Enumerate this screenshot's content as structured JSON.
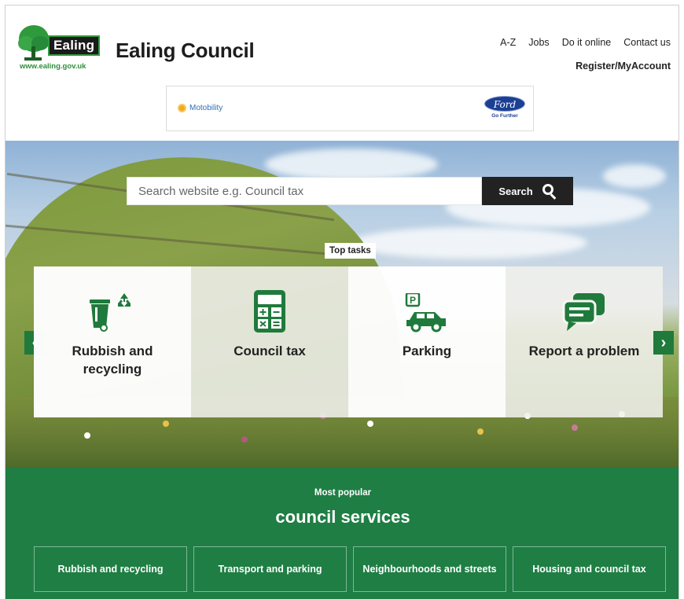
{
  "header": {
    "logo_word": "Ealing",
    "logo_url": "www.ealing.gov.uk",
    "site_title": "Ealing Council",
    "nav": [
      "A-Z",
      "Jobs",
      "Do it online",
      "Contact us"
    ],
    "account_link": "Register/MyAccount"
  },
  "ad": {
    "left_brand": "Motobility",
    "right_brand": "Ford",
    "right_tagline": "Go Further"
  },
  "search": {
    "placeholder": "Search website e.g. Council tax",
    "button_label": "Search"
  },
  "top_tasks": {
    "label": "Top tasks",
    "items": [
      {
        "label": "Rubbish and recycling",
        "icon": "bin-recycle-icon"
      },
      {
        "label": "Council tax",
        "icon": "calculator-icon"
      },
      {
        "label": "Parking",
        "icon": "car-parking-icon"
      },
      {
        "label": "Report a problem",
        "icon": "speech-bubbles-icon"
      }
    ],
    "prev_label": "‹",
    "next_label": "›"
  },
  "popular": {
    "kicker": "Most popular",
    "title": "council services",
    "services": [
      "Rubbish and recycling",
      "Transport and parking",
      "Neighbourhoods and streets",
      "Housing and council tax"
    ]
  },
  "colors": {
    "brand_green": "#1f7e44",
    "icon_green": "#1f7a3c",
    "dark": "#222222"
  }
}
